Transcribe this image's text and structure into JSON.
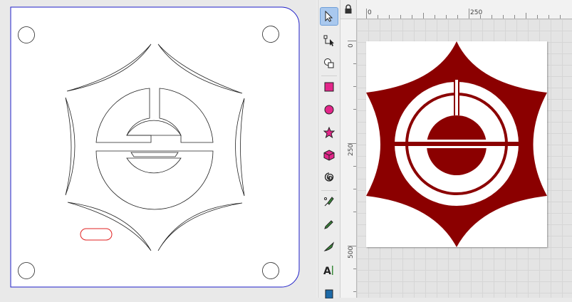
{
  "toolbox": {
    "tools": [
      {
        "id": "selector",
        "icon": "selector-arrow-icon",
        "active": true
      },
      {
        "id": "node",
        "icon": "node-edit-icon",
        "active": false
      },
      {
        "id": "shape-builder",
        "icon": "shape-builder-icon",
        "active": false
      },
      {
        "id": "rectangle",
        "icon": "rectangle-icon",
        "active": false
      },
      {
        "id": "ellipse",
        "icon": "ellipse-icon",
        "active": false
      },
      {
        "id": "star",
        "icon": "star-icon",
        "active": false
      },
      {
        "id": "box3d",
        "icon": "box-3d-icon",
        "active": false
      },
      {
        "id": "spiral",
        "icon": "spiral-icon",
        "active": false
      },
      {
        "id": "pen",
        "icon": "pen-icon",
        "active": false
      },
      {
        "id": "pencil",
        "icon": "pencil-icon",
        "active": false
      },
      {
        "id": "calligraphy",
        "icon": "calligraphy-icon",
        "active": false
      },
      {
        "id": "text",
        "icon": "text-icon",
        "active": false
      },
      {
        "id": "gradient",
        "icon": "gradient-icon",
        "active": false
      }
    ]
  },
  "ruler": {
    "top_labels": [
      "0",
      "250"
    ],
    "left_labels": [
      "0",
      "250",
      "500"
    ]
  },
  "colors": {
    "emblem_red": "#8b0000",
    "outline_blue": "#1e1ec8",
    "slot_red": "#e02020",
    "active_tool_bg": "#a9c8ee"
  },
  "icons": {
    "lock": "lock-icon"
  }
}
